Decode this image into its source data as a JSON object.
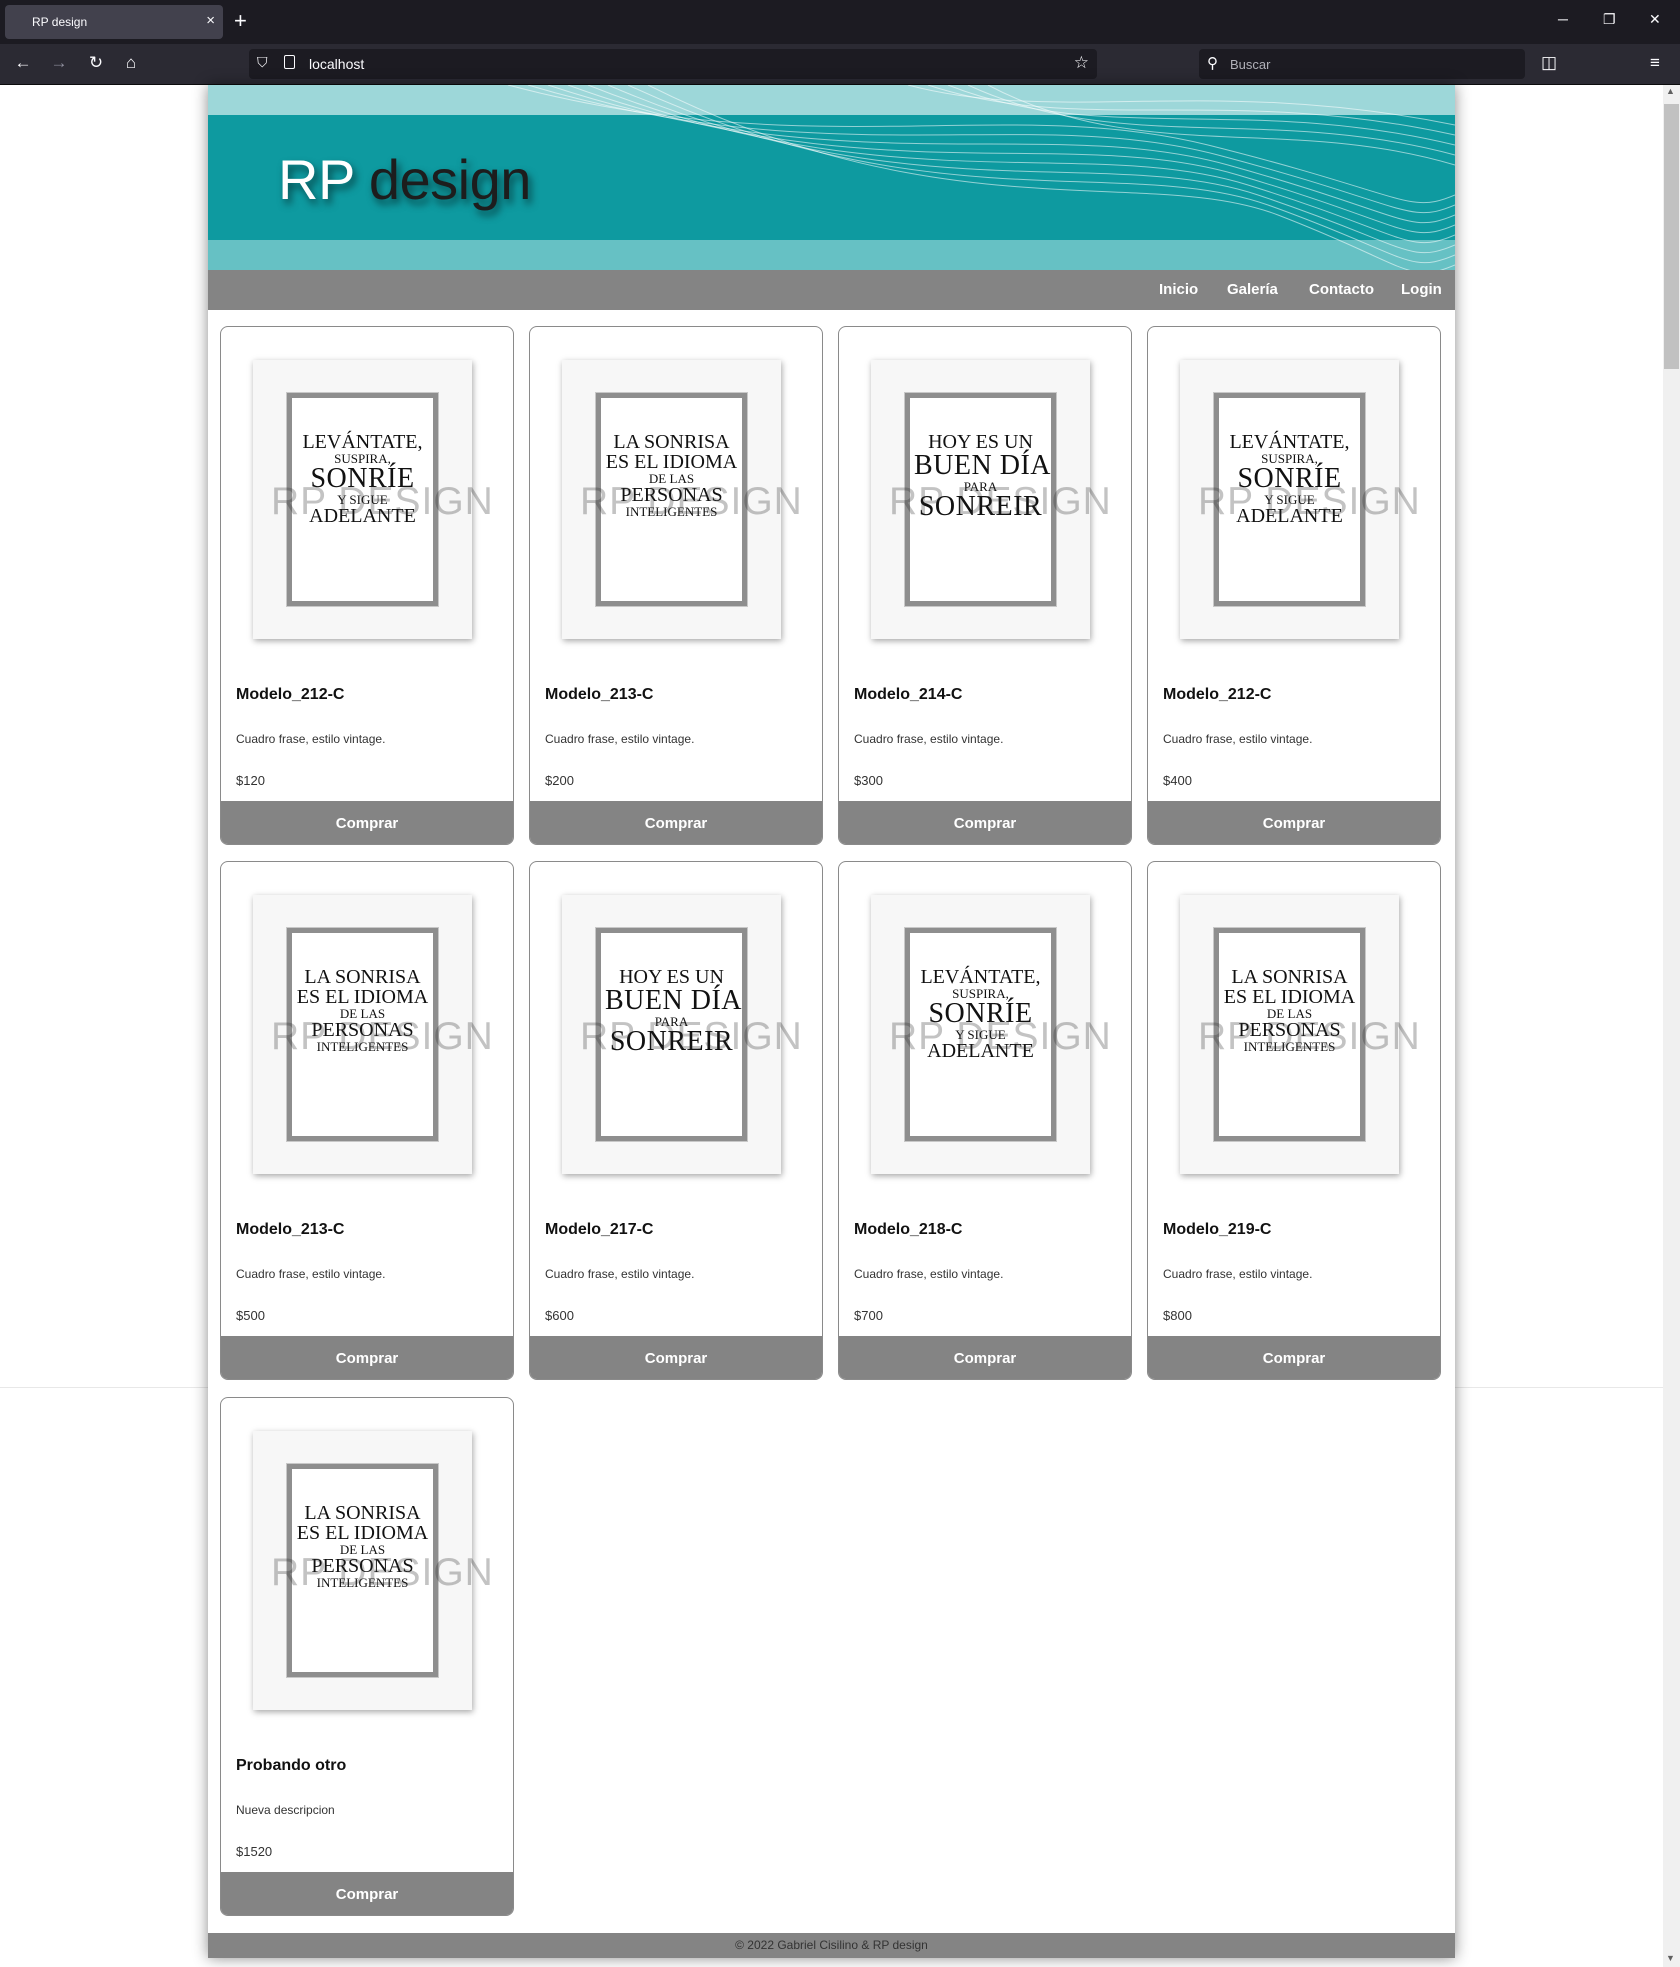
{
  "browser": {
    "tab_title": "RP design",
    "tab_close": "×",
    "new_tab": "+",
    "url": "localhost",
    "search_placeholder": "Buscar",
    "controls": {
      "minimize": "─",
      "restore": "❐",
      "close": "✕"
    },
    "nav": {
      "back": "←",
      "forward": "→",
      "reload": "↻",
      "home": "⌂",
      "star": "☆",
      "pocket": "◫",
      "menu": "≡"
    }
  },
  "site": {
    "title_a": "RP",
    "title_b": " design",
    "menu": [
      "Inicio",
      "Galería",
      "Contacto",
      "Login"
    ],
    "buy_label": "Comprar",
    "watermark": "RP DESIGN",
    "footer": "© 2022 Gabriel Cisilino & RP design"
  },
  "products": [
    {
      "name": "Modelo_212-C",
      "desc": "Cuadro frase, estilo vintage.",
      "price": "$120",
      "art": "sonrie"
    },
    {
      "name": "Modelo_213-C",
      "desc": "Cuadro frase, estilo vintage.",
      "price": "$200",
      "art": "sonrisa"
    },
    {
      "name": "Modelo_214-C",
      "desc": "Cuadro frase, estilo vintage.",
      "price": "$300",
      "art": "hoy"
    },
    {
      "name": "Modelo_212-C",
      "desc": "Cuadro frase, estilo vintage.",
      "price": "$400",
      "art": "sonrie"
    },
    {
      "name": "Modelo_213-C",
      "desc": "Cuadro frase, estilo vintage.",
      "price": "$500",
      "art": "sonrisa"
    },
    {
      "name": "Modelo_217-C",
      "desc": "Cuadro frase, estilo vintage.",
      "price": "$600",
      "art": "hoy"
    },
    {
      "name": "Modelo_218-C",
      "desc": "Cuadro frase, estilo vintage.",
      "price": "$700",
      "art": "sonrie"
    },
    {
      "name": "Modelo_219-C",
      "desc": "Cuadro frase, estilo vintage.",
      "price": "$800",
      "art": "sonrisa"
    },
    {
      "name": "Probando otro",
      "desc": "Nueva descripcion",
      "price": "$1520",
      "art": "sonrisa"
    }
  ],
  "artwork": {
    "sonrie": [
      "LEVÁNTATE,",
      "SUSPIRA,",
      "SONRÍE",
      "Y SIGUE",
      "ADELANTE"
    ],
    "sonrisa": [
      "LA SONRISA",
      "ES EL IDIOMA",
      "DE LAS",
      "PERSONAS",
      "INTELIGENTES"
    ],
    "hoy": [
      "HOY ES UN",
      "BUEN DÍA",
      "PARA",
      "SONREIR"
    ]
  },
  "colors": {
    "banner": "#0e9aa0",
    "menu": "#848484",
    "button": "#848484"
  }
}
